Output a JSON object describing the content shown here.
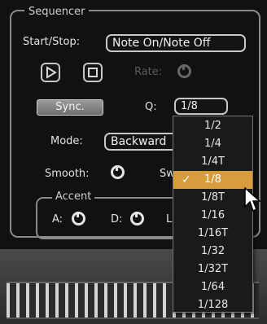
{
  "sequencer": {
    "title": "Sequencer",
    "start_stop_label": "Start/Stop:",
    "start_stop_value": "Note On/Note Off",
    "play_icon": "play-icon",
    "stop_icon": "stop-icon",
    "rate_label": "Rate:",
    "sync_label": "Sync.",
    "q_label": "Q:",
    "q_value": "1/8",
    "mode_label": "Mode:",
    "mode_value": "Backward",
    "smooth_label": "Smooth:",
    "swing_label_partial": "Sw"
  },
  "accent": {
    "title": "Accent",
    "a_label": "A:",
    "d_label": "D:",
    "l_label": "L"
  },
  "q_dropdown": {
    "options": [
      "1/2",
      "1/4",
      "1/4T",
      "1/8",
      "1/8T",
      "1/16",
      "1/16T",
      "1/32",
      "1/32T",
      "1/64",
      "1/128"
    ],
    "selected": "1/8",
    "check_mark": "✓"
  },
  "colors": {
    "selection": "#d79c3b",
    "panel_bg": "#111111",
    "outline": "#c8c8c8"
  }
}
